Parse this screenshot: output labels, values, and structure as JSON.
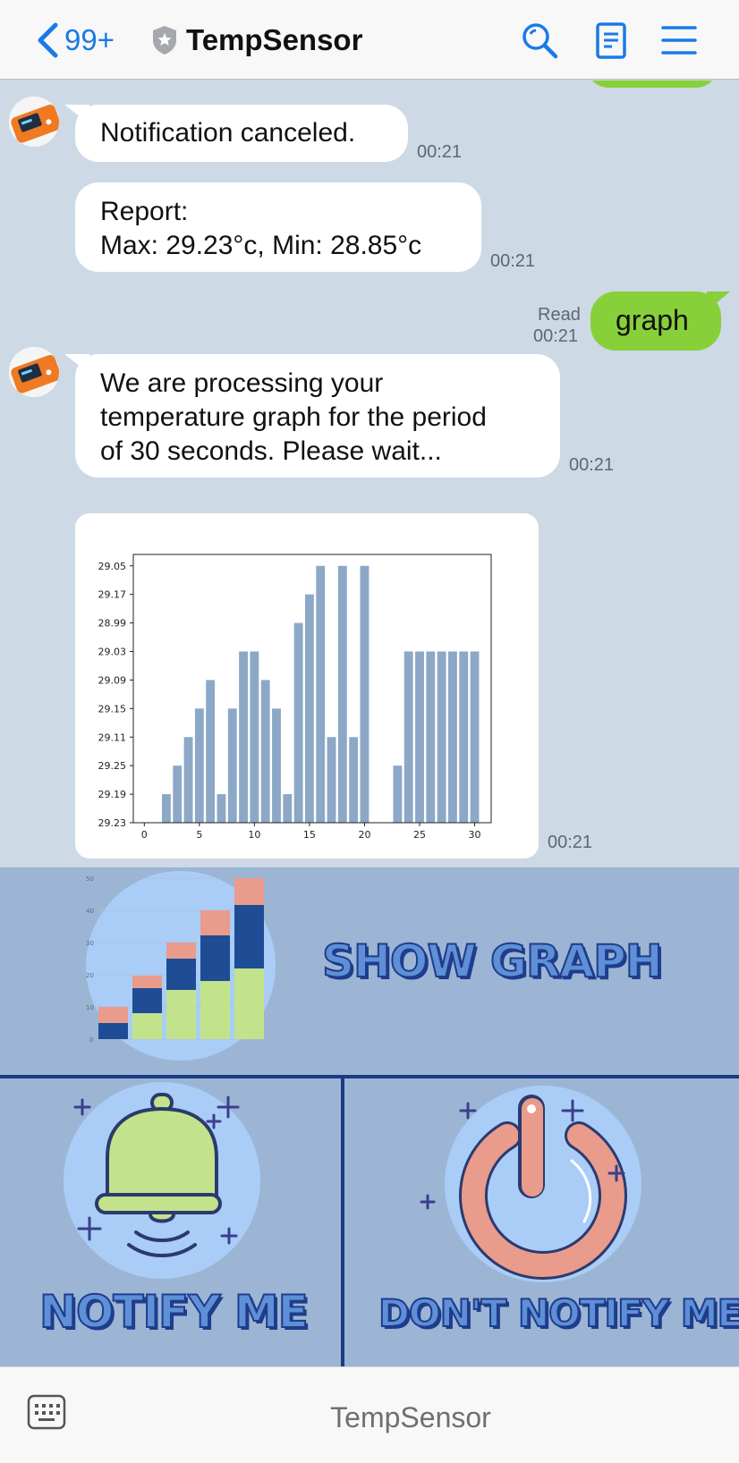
{
  "header": {
    "back_count": "99+",
    "title": "TempSensor",
    "icons": [
      "chevron-left-icon",
      "shield-icon",
      "search-icon",
      "notes-icon",
      "menu-icon"
    ]
  },
  "messages": {
    "m1": {
      "text": "Notification canceled.",
      "time": "00:21"
    },
    "m2": {
      "line1": "Report:",
      "line2": "Max: 29.23°c, Min: 28.85°c",
      "time": "00:21"
    },
    "m3": {
      "text": "graph",
      "read": "Read",
      "time": "00:21"
    },
    "m4": {
      "line1": "We are processing your",
      "line2": "temperature graph for the period",
      "line3": "of 30 seconds. Please wait...",
      "time": "00:21"
    },
    "m5": {
      "time": "00:21"
    }
  },
  "chart_data": {
    "type": "bar",
    "x": [
      2,
      3,
      4,
      5,
      6,
      7,
      8,
      9,
      10,
      11,
      12,
      13,
      14,
      15,
      16,
      17,
      18,
      19,
      20,
      23,
      24,
      25,
      26,
      27,
      28,
      29,
      30
    ],
    "values": [
      1,
      2,
      3,
      4,
      5,
      1,
      4,
      6,
      6,
      5,
      4,
      1,
      7,
      8,
      9,
      3,
      9,
      3,
      9,
      2,
      6,
      6,
      6,
      6,
      6,
      6,
      6
    ],
    "ytick_labels": [
      "29.23",
      "29.19",
      "29.25",
      "29.11",
      "29.15",
      "29.09",
      "29.03",
      "28.99",
      "29.17",
      "29.05"
    ],
    "xticks": [
      0,
      5,
      10,
      15,
      20,
      25,
      30
    ],
    "xlim": [
      -1,
      31.5
    ],
    "ylim": [
      0,
      9.4
    ],
    "color": "#8ca8c6"
  },
  "rich_menu": {
    "show_graph": "SHOW GRAPH",
    "notify_me": "NOTIFY ME",
    "dont_notify_me": "DON'T NOTIFY ME",
    "mini_chart_ticks": [
      "0",
      "10",
      "20",
      "30",
      "40",
      "50"
    ]
  },
  "footer": {
    "label": "TempSensor"
  },
  "colors": {
    "accent": "#1a7ae6",
    "green_bubble": "#87d03a",
    "menu_bg": "#9db5d4",
    "menu_text": "#5f8fd6",
    "menu_outline": "#1e3d8c"
  }
}
